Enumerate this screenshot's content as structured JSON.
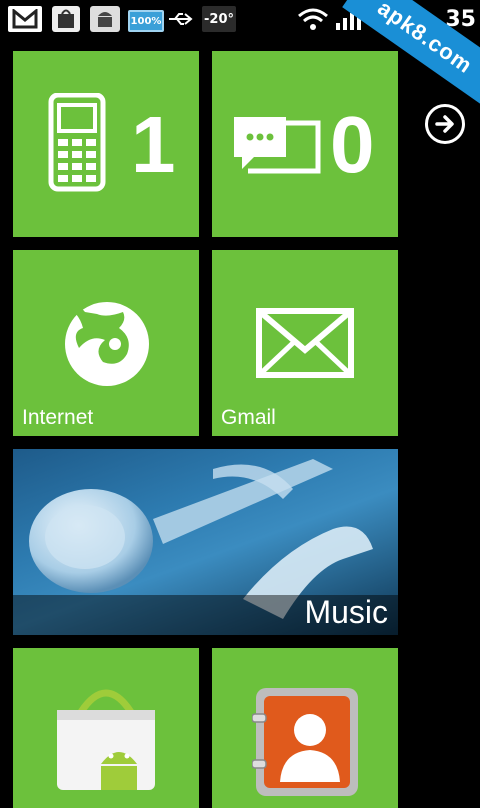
{
  "status_bar": {
    "battery_percent": "100%",
    "temperature": "-20°",
    "time": "35"
  },
  "watermark": "apk8.com",
  "tiles": {
    "phone": {
      "count": "1"
    },
    "messages": {
      "count": "0"
    },
    "internet": {
      "label": "Internet"
    },
    "gmail": {
      "label": "Gmail"
    },
    "music": {
      "label": "Music"
    }
  },
  "colors": {
    "tile_green": "#6cc13c",
    "background": "#000000",
    "watermark_blue": "#1a8fd6"
  }
}
